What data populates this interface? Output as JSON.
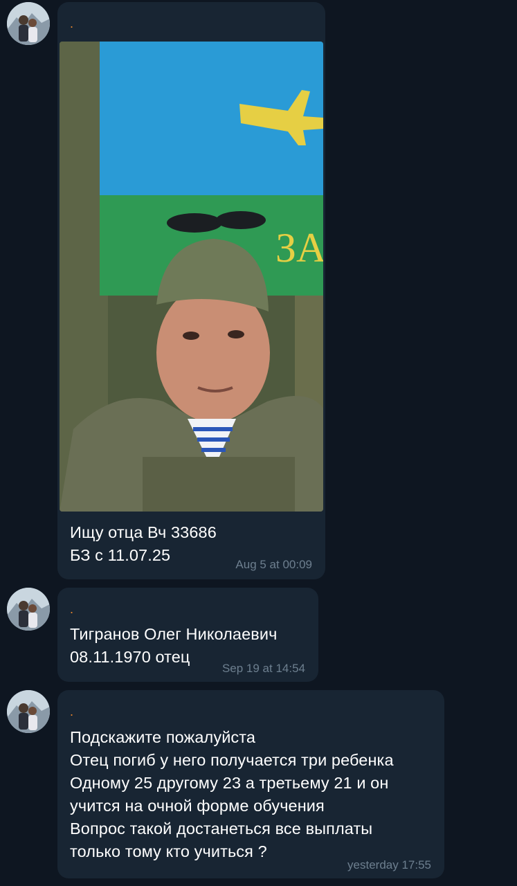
{
  "messages": [
    {
      "sender": ".",
      "has_photo": true,
      "text": "Ищу отца Вч 33686\nБЗ с 11.07.25",
      "time": "Aug 5 at 00:09"
    },
    {
      "sender": ".",
      "has_photo": false,
      "text": "Тигранов Олег Николаевич\n08.11.1970 отец",
      "time": "Sep 19 at 14:54"
    },
    {
      "sender": ".",
      "has_photo": false,
      "text": "Подскажите пожалуйста\nОтец погиб у него получается три ребенка\nОдному 25 другому 23 а третьему 21 и он\nучится на очной форме обучения\nВопрос такой достанеться все выплаты\nтолько тому кто учиться ?",
      "time": "yesterday 17:55"
    }
  ],
  "photo": {
    "flag_text": "ЗА"
  },
  "colors": {
    "background": "#0e1621",
    "bubble": "#182533",
    "sender_accent": "#e8852d",
    "timestamp": "#6d7f8f",
    "text": "#ffffff"
  }
}
